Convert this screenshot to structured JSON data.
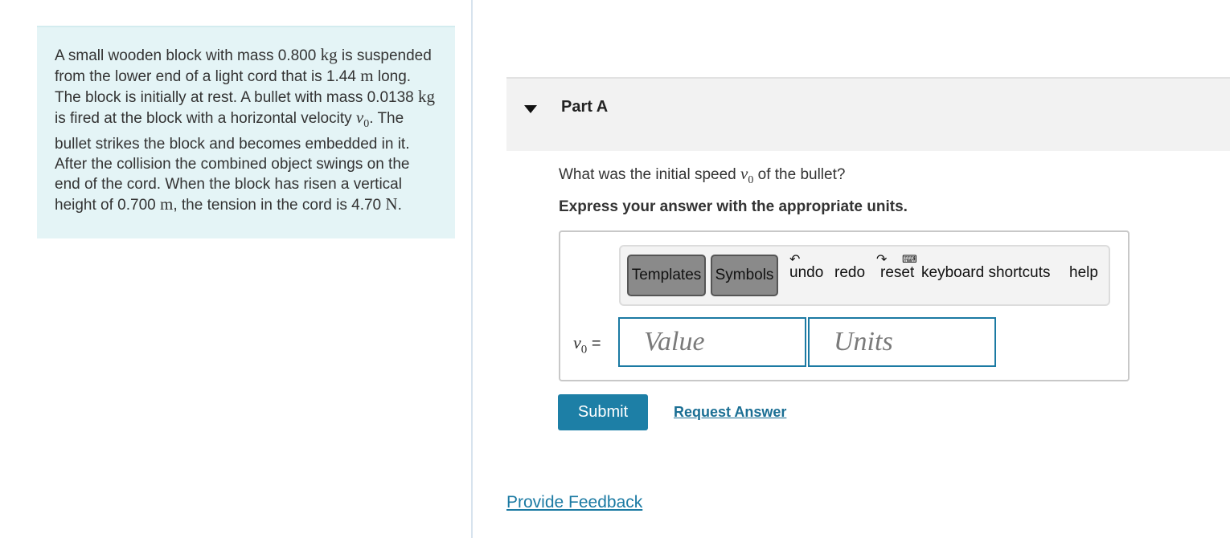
{
  "problem": {
    "text_1": "A small wooden block with mass 0.800 ",
    "unit_kg_1": "kg",
    "text_2": " is suspended from the lower end of a light cord that is 1.44 ",
    "unit_m_1": "m",
    "text_3": " long. The block is initially at rest. A bullet with mass 0.0138 ",
    "unit_kg_2": "kg",
    "text_4": " is fired at the block with a horizontal velocity ",
    "var_v": "v",
    "var_sub": "0",
    "text_5": ". The bullet strikes the block and becomes embedded in it. After the collision the combined object swings on the end of the cord. When the block has risen a vertical height of 0.700 ",
    "unit_m_2": "m",
    "text_6": ", the tension in the cord is 4.70 ",
    "unit_N": "N",
    "text_7": "."
  },
  "part": {
    "title": "Part A"
  },
  "question": {
    "text_before": "What was the initial speed ",
    "var_v": "v",
    "var_sub": "0",
    "text_after": " of the bullet?",
    "instruction": "Express your answer with the appropriate units."
  },
  "toolbar": {
    "templates": "Templates",
    "symbols": "Symbols",
    "undo": "undo",
    "redo": "redo",
    "reset": "reset",
    "keyboard_shortcuts": "keyboard shortcuts",
    "help": "help"
  },
  "answer": {
    "var_v": "v",
    "var_sub": "0",
    "equals": " =",
    "value_placeholder": "Value",
    "units_placeholder": "Units"
  },
  "actions": {
    "submit": "Submit",
    "request_answer": "Request Answer",
    "feedback": "Provide Feedback"
  }
}
